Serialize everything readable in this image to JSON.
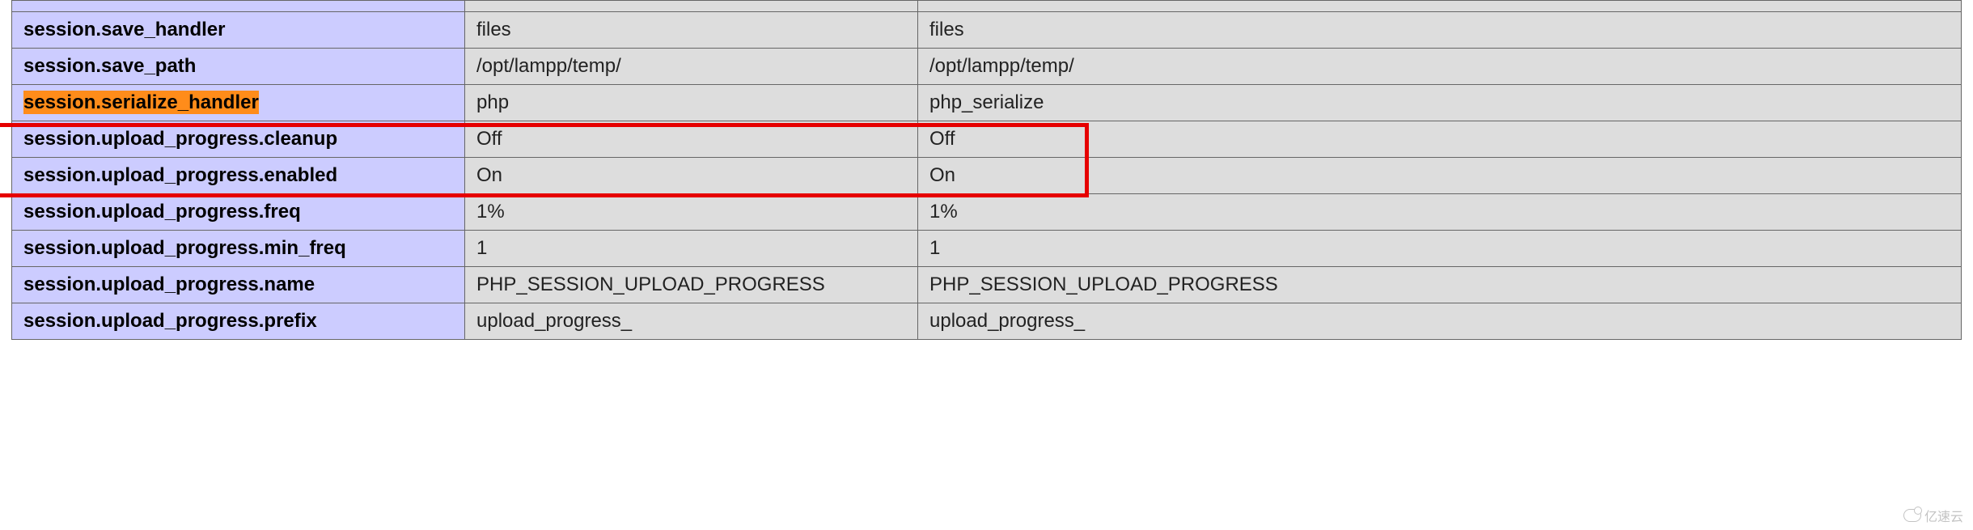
{
  "rows": [
    {
      "directive": "",
      "local": "",
      "master": "",
      "truncated": true
    },
    {
      "directive": "session.save_handler",
      "local": "files",
      "master": "files"
    },
    {
      "directive": "session.save_path",
      "local": "/opt/lampp/temp/",
      "master": "/opt/lampp/temp/"
    },
    {
      "directive": "session.serialize_handler",
      "local": "php",
      "master": "php_serialize",
      "highlight": true
    },
    {
      "directive": "session.upload_progress.cleanup",
      "local": "Off",
      "master": "Off"
    },
    {
      "directive": "session.upload_progress.enabled",
      "local": "On",
      "master": "On"
    },
    {
      "directive": "session.upload_progress.freq",
      "local": "1%",
      "master": "1%"
    },
    {
      "directive": "session.upload_progress.min_freq",
      "local": "1",
      "master": "1"
    },
    {
      "directive": "session.upload_progress.name",
      "local": "PHP_SESSION_UPLOAD_PROGRESS",
      "master": "PHP_SESSION_UPLOAD_PROGRESS"
    },
    {
      "directive": "session.upload_progress.prefix",
      "local": "upload_progress_",
      "master": "upload_progress_"
    }
  ],
  "watermark": "亿速云"
}
